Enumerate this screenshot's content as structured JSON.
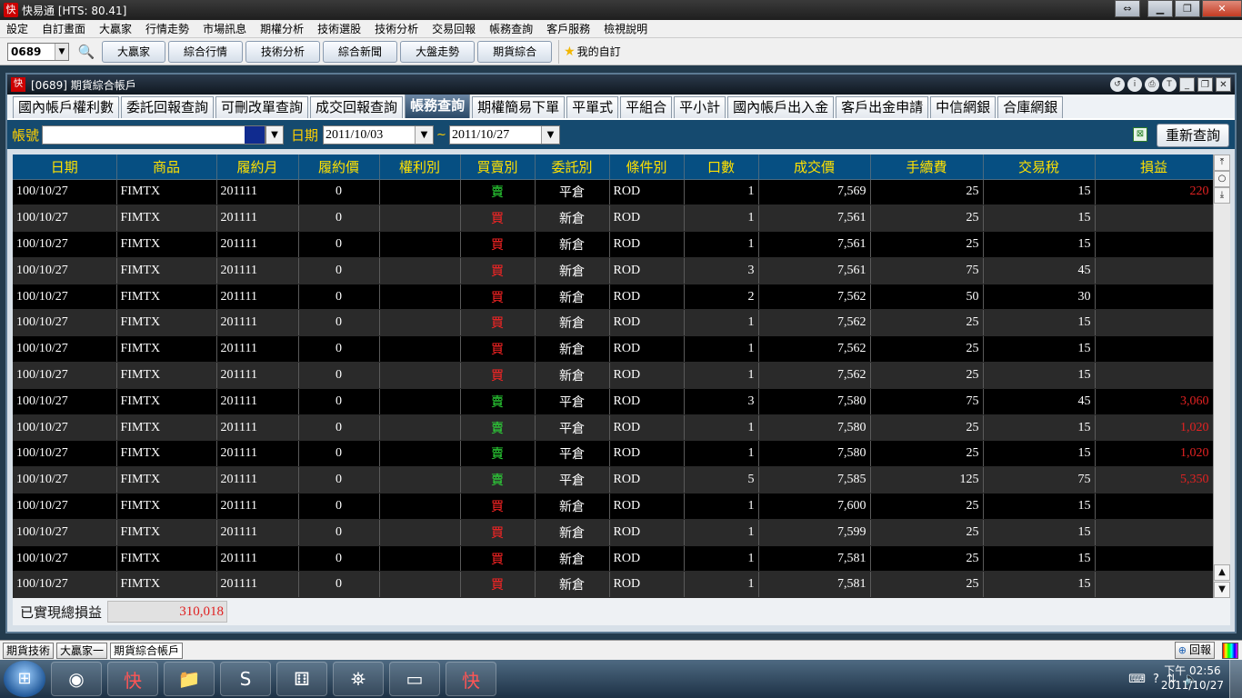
{
  "app": {
    "title": "快易通  [HTS: 80.41]",
    "logo_text": "快"
  },
  "menu": [
    "設定",
    "自訂畫面",
    "大贏家",
    "行情走勢",
    "市場訊息",
    "期權分析",
    "技術選股",
    "技術分析",
    "交易回報",
    "帳務查詢",
    "客戶服務",
    "檢視說明"
  ],
  "toolbar": {
    "stock_code": "0689",
    "buttons": [
      "大贏家",
      "綜合行情",
      "技術分析",
      "綜合新聞",
      "大盤走勢",
      "期貨綜合"
    ],
    "favorites_label": "我的自訂"
  },
  "child_window": {
    "title": "[0689] 期貨綜合帳戶",
    "tabs": [
      "國內帳戶權利數",
      "委託回報查詢",
      "可刪改單查詢",
      "成交回報查詢",
      "帳務查詢",
      "期權簡易下單",
      "平單式",
      "平組合",
      "平小計",
      "國內帳戶出入金",
      "客戶出金申請",
      "中信網銀",
      "合庫網銀"
    ],
    "active_tab": 4
  },
  "filter": {
    "account_label": "帳號",
    "account_value": "",
    "date_label": "日期",
    "date_from": "2011/10/03",
    "date_sep": "~",
    "date_to": "2011/10/27",
    "requery_label": "重新查詢"
  },
  "table": {
    "columns": [
      "日期",
      "商品",
      "履約月",
      "履約價",
      "權利別",
      "買賣別",
      "委託別",
      "條件別",
      "口數",
      "成交價",
      "手續費",
      "交易稅",
      "損益"
    ],
    "rows": [
      [
        "100/10/27",
        "FIMTX",
        "201111",
        "0",
        "",
        "賣",
        "平倉",
        "ROD",
        "1",
        "7,569",
        "25",
        "15",
        "220"
      ],
      [
        "100/10/27",
        "FIMTX",
        "201111",
        "0",
        "",
        "買",
        "新倉",
        "ROD",
        "1",
        "7,561",
        "25",
        "15",
        ""
      ],
      [
        "100/10/27",
        "FIMTX",
        "201111",
        "0",
        "",
        "買",
        "新倉",
        "ROD",
        "1",
        "7,561",
        "25",
        "15",
        ""
      ],
      [
        "100/10/27",
        "FIMTX",
        "201111",
        "0",
        "",
        "買",
        "新倉",
        "ROD",
        "3",
        "7,561",
        "75",
        "45",
        ""
      ],
      [
        "100/10/27",
        "FIMTX",
        "201111",
        "0",
        "",
        "買",
        "新倉",
        "ROD",
        "2",
        "7,562",
        "50",
        "30",
        ""
      ],
      [
        "100/10/27",
        "FIMTX",
        "201111",
        "0",
        "",
        "買",
        "新倉",
        "ROD",
        "1",
        "7,562",
        "25",
        "15",
        ""
      ],
      [
        "100/10/27",
        "FIMTX",
        "201111",
        "0",
        "",
        "買",
        "新倉",
        "ROD",
        "1",
        "7,562",
        "25",
        "15",
        ""
      ],
      [
        "100/10/27",
        "FIMTX",
        "201111",
        "0",
        "",
        "買",
        "新倉",
        "ROD",
        "1",
        "7,562",
        "25",
        "15",
        ""
      ],
      [
        "100/10/27",
        "FIMTX",
        "201111",
        "0",
        "",
        "賣",
        "平倉",
        "ROD",
        "3",
        "7,580",
        "75",
        "45",
        "3,060"
      ],
      [
        "100/10/27",
        "FIMTX",
        "201111",
        "0",
        "",
        "賣",
        "平倉",
        "ROD",
        "1",
        "7,580",
        "25",
        "15",
        "1,020"
      ],
      [
        "100/10/27",
        "FIMTX",
        "201111",
        "0",
        "",
        "賣",
        "平倉",
        "ROD",
        "1",
        "7,580",
        "25",
        "15",
        "1,020"
      ],
      [
        "100/10/27",
        "FIMTX",
        "201111",
        "0",
        "",
        "賣",
        "平倉",
        "ROD",
        "5",
        "7,585",
        "125",
        "75",
        "5,350"
      ],
      [
        "100/10/27",
        "FIMTX",
        "201111",
        "0",
        "",
        "買",
        "新倉",
        "ROD",
        "1",
        "7,600",
        "25",
        "15",
        ""
      ],
      [
        "100/10/27",
        "FIMTX",
        "201111",
        "0",
        "",
        "買",
        "新倉",
        "ROD",
        "1",
        "7,599",
        "25",
        "15",
        ""
      ],
      [
        "100/10/27",
        "FIMTX",
        "201111",
        "0",
        "",
        "買",
        "新倉",
        "ROD",
        "1",
        "7,581",
        "25",
        "15",
        ""
      ],
      [
        "100/10/27",
        "FIMTX",
        "201111",
        "0",
        "",
        "買",
        "新倉",
        "ROD",
        "1",
        "7,581",
        "25",
        "15",
        ""
      ]
    ]
  },
  "summary": {
    "label": "已實現總損益",
    "value": "310,018"
  },
  "bottom_tabs": [
    "期貨技術",
    "大贏家一",
    "期貨綜合帳戶"
  ],
  "bottom_report": "回報",
  "taskbar": {
    "apps": [
      "chrome-icon",
      "app-red-icon",
      "explorer-icon",
      "skype-icon",
      "dice-icon",
      "network-app-icon",
      "window-icon",
      "hts-icon"
    ],
    "clock_time": "下午 02:56",
    "clock_date": "2011/10/27"
  },
  "colors": {
    "sell": "#2ee33a",
    "buy": "#ff2424",
    "profit": "#e32222",
    "header_bg": "#064f82",
    "header_text": "#ffe100",
    "filter_bg": "#154a6f"
  }
}
